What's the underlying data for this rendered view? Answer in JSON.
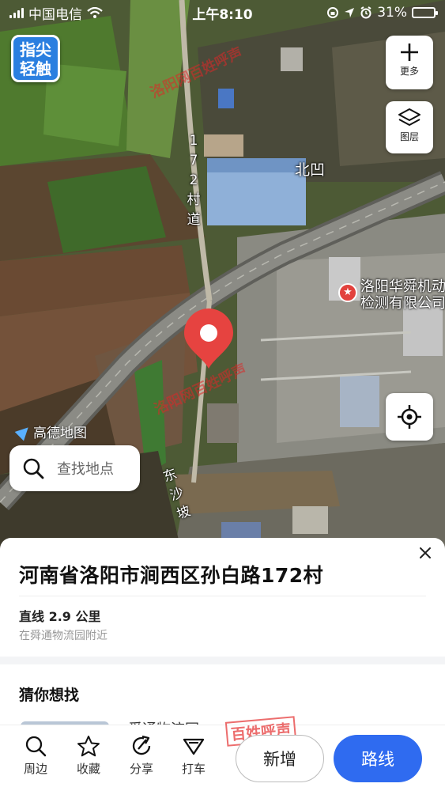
{
  "status_bar": {
    "carrier": "中国电信",
    "time": "上午8:10",
    "battery": "31%",
    "battery_level": 0.31
  },
  "logo": {
    "line1": "指尖",
    "line2": "轻触"
  },
  "map": {
    "buttons": {
      "more_label": "更多",
      "layers_label": "图层"
    },
    "labels": {
      "village_road": [
        "1",
        "7",
        "2",
        "村",
        "道"
      ],
      "beiao": "北凹",
      "dongshapo": [
        "东",
        "沙",
        "坡"
      ]
    },
    "poi": {
      "name": "洛阳华舜机动车\n检测有限公司"
    },
    "provider": "高德地图",
    "watermarks": {
      "site": "洛阳网",
      "brand": "百姓呼声"
    },
    "search": {
      "placeholder": "查找地点"
    }
  },
  "sheet": {
    "title": "河南省洛阳市涧西区孙白路172村",
    "distance": "直线 2.9 公里",
    "nearby": "在舜通物流园附近",
    "guess_title": "猜你想找",
    "peek_text": "舜通物流园"
  },
  "toolbar": {
    "items": [
      {
        "label": "周边",
        "icon": "search-icon"
      },
      {
        "label": "收藏",
        "icon": "star-icon"
      },
      {
        "label": "分享",
        "icon": "share-icon"
      },
      {
        "label": "打车",
        "icon": "taxi-icon"
      }
    ],
    "new_label": "新增",
    "route_label": "路线"
  },
  "colors": {
    "route_button": "#2f6bf0",
    "pin": "#e64340",
    "brand_logo": "#2a7fe0"
  }
}
